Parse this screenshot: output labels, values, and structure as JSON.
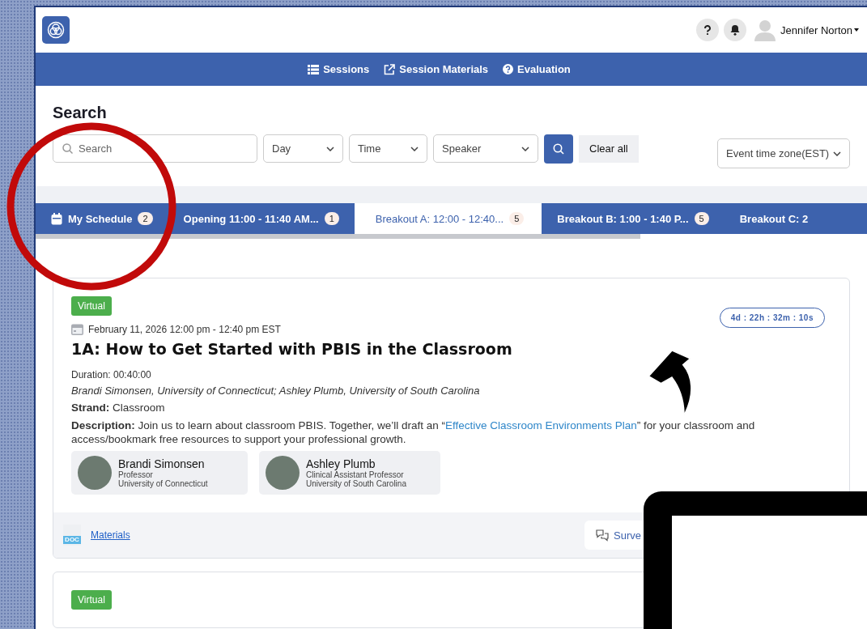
{
  "header": {
    "user_name": "Jennifer Norton"
  },
  "nav": [
    {
      "label": "Sessions"
    },
    {
      "label": "Session Materials"
    },
    {
      "label": "Evaluation"
    }
  ],
  "search": {
    "heading": "Search",
    "placeholder": "Search",
    "filters": [
      "Day",
      "Time",
      "Speaker"
    ],
    "clear_label": "Clear all",
    "timezone": "Event time zone(EST)"
  },
  "tabs": [
    {
      "kind": "schedule",
      "label": "My Schedule",
      "count": "2",
      "selected": false
    },
    {
      "kind": "slot",
      "label": "Opening 11:00 - 11:40 AM...",
      "count": "1",
      "selected": false
    },
    {
      "kind": "slot",
      "label": "Breakout A: 12:00 - 12:40...",
      "count": "5",
      "selected": true
    },
    {
      "kind": "slot",
      "label": "Breakout B: 1:00 - 1:40 P...",
      "count": "5",
      "selected": false
    },
    {
      "kind": "slot",
      "label": "Breakout C: 2",
      "selected": false
    }
  ],
  "sessions": [
    {
      "badge": "Virtual",
      "datetime": "February 11, 2026 12:00 pm - 12:40 pm EST",
      "countdown": "4d : 22h : 32m : 10s",
      "title": "1A: How to Get Started with PBIS in the Classroom",
      "duration": "Duration: 00:40:00",
      "presenters": "Brandi Simonsen, University of Connecticut; Ashley Plumb, University of South Carolina",
      "strand": "**Strand:** Classroom",
      "description_before": "**Description:** Join us to learn about classroom PBIS. Together, we’ll draft an “",
      "description_link": "Effective Classroom Environments Plan",
      "description_after": "” for your classroom and access/bookmark free resources to support your professional growth.",
      "speakers": [
        {
          "name": "Brandi Simonsen",
          "role": "Professor",
          "org": "University of Connecticut"
        },
        {
          "name": "Ashley Plumb",
          "role": "Clinical Assistant Professor",
          "org": "University of South Carolina"
        }
      ],
      "materials_file_type": "DOC",
      "materials_label": "Materials",
      "survey_label": "Surve"
    },
    {
      "badge": "Virtual"
    }
  ]
}
